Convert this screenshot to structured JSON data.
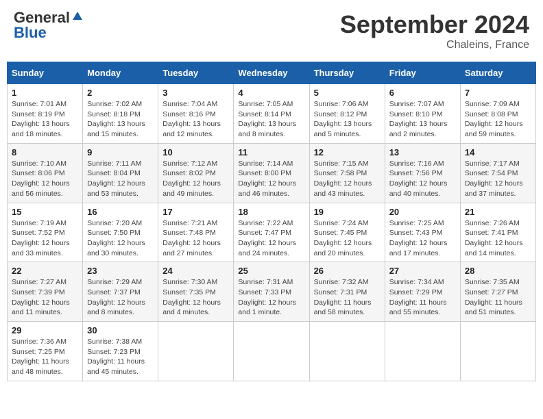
{
  "logo": {
    "line1": "General",
    "line2": "Blue"
  },
  "title": "September 2024",
  "location": "Chaleins, France",
  "days_of_week": [
    "Sunday",
    "Monday",
    "Tuesday",
    "Wednesday",
    "Thursday",
    "Friday",
    "Saturday"
  ],
  "weeks": [
    [
      {
        "day": "1",
        "info": "Sunrise: 7:01 AM\nSunset: 8:19 PM\nDaylight: 13 hours\nand 18 minutes."
      },
      {
        "day": "2",
        "info": "Sunrise: 7:02 AM\nSunset: 8:18 PM\nDaylight: 13 hours\nand 15 minutes."
      },
      {
        "day": "3",
        "info": "Sunrise: 7:04 AM\nSunset: 8:16 PM\nDaylight: 13 hours\nand 12 minutes."
      },
      {
        "day": "4",
        "info": "Sunrise: 7:05 AM\nSunset: 8:14 PM\nDaylight: 13 hours\nand 8 minutes."
      },
      {
        "day": "5",
        "info": "Sunrise: 7:06 AM\nSunset: 8:12 PM\nDaylight: 13 hours\nand 5 minutes."
      },
      {
        "day": "6",
        "info": "Sunrise: 7:07 AM\nSunset: 8:10 PM\nDaylight: 13 hours\nand 2 minutes."
      },
      {
        "day": "7",
        "info": "Sunrise: 7:09 AM\nSunset: 8:08 PM\nDaylight: 12 hours\nand 59 minutes."
      }
    ],
    [
      {
        "day": "8",
        "info": "Sunrise: 7:10 AM\nSunset: 8:06 PM\nDaylight: 12 hours\nand 56 minutes."
      },
      {
        "day": "9",
        "info": "Sunrise: 7:11 AM\nSunset: 8:04 PM\nDaylight: 12 hours\nand 53 minutes."
      },
      {
        "day": "10",
        "info": "Sunrise: 7:12 AM\nSunset: 8:02 PM\nDaylight: 12 hours\nand 49 minutes."
      },
      {
        "day": "11",
        "info": "Sunrise: 7:14 AM\nSunset: 8:00 PM\nDaylight: 12 hours\nand 46 minutes."
      },
      {
        "day": "12",
        "info": "Sunrise: 7:15 AM\nSunset: 7:58 PM\nDaylight: 12 hours\nand 43 minutes."
      },
      {
        "day": "13",
        "info": "Sunrise: 7:16 AM\nSunset: 7:56 PM\nDaylight: 12 hours\nand 40 minutes."
      },
      {
        "day": "14",
        "info": "Sunrise: 7:17 AM\nSunset: 7:54 PM\nDaylight: 12 hours\nand 37 minutes."
      }
    ],
    [
      {
        "day": "15",
        "info": "Sunrise: 7:19 AM\nSunset: 7:52 PM\nDaylight: 12 hours\nand 33 minutes."
      },
      {
        "day": "16",
        "info": "Sunrise: 7:20 AM\nSunset: 7:50 PM\nDaylight: 12 hours\nand 30 minutes."
      },
      {
        "day": "17",
        "info": "Sunrise: 7:21 AM\nSunset: 7:48 PM\nDaylight: 12 hours\nand 27 minutes."
      },
      {
        "day": "18",
        "info": "Sunrise: 7:22 AM\nSunset: 7:47 PM\nDaylight: 12 hours\nand 24 minutes."
      },
      {
        "day": "19",
        "info": "Sunrise: 7:24 AM\nSunset: 7:45 PM\nDaylight: 12 hours\nand 20 minutes."
      },
      {
        "day": "20",
        "info": "Sunrise: 7:25 AM\nSunset: 7:43 PM\nDaylight: 12 hours\nand 17 minutes."
      },
      {
        "day": "21",
        "info": "Sunrise: 7:26 AM\nSunset: 7:41 PM\nDaylight: 12 hours\nand 14 minutes."
      }
    ],
    [
      {
        "day": "22",
        "info": "Sunrise: 7:27 AM\nSunset: 7:39 PM\nDaylight: 12 hours\nand 11 minutes."
      },
      {
        "day": "23",
        "info": "Sunrise: 7:29 AM\nSunset: 7:37 PM\nDaylight: 12 hours\nand 8 minutes."
      },
      {
        "day": "24",
        "info": "Sunrise: 7:30 AM\nSunset: 7:35 PM\nDaylight: 12 hours\nand 4 minutes."
      },
      {
        "day": "25",
        "info": "Sunrise: 7:31 AM\nSunset: 7:33 PM\nDaylight: 12 hours\nand 1 minute."
      },
      {
        "day": "26",
        "info": "Sunrise: 7:32 AM\nSunset: 7:31 PM\nDaylight: 11 hours\nand 58 minutes."
      },
      {
        "day": "27",
        "info": "Sunrise: 7:34 AM\nSunset: 7:29 PM\nDaylight: 11 hours\nand 55 minutes."
      },
      {
        "day": "28",
        "info": "Sunrise: 7:35 AM\nSunset: 7:27 PM\nDaylight: 11 hours\nand 51 minutes."
      }
    ],
    [
      {
        "day": "29",
        "info": "Sunrise: 7:36 AM\nSunset: 7:25 PM\nDaylight: 11 hours\nand 48 minutes."
      },
      {
        "day": "30",
        "info": "Sunrise: 7:38 AM\nSunset: 7:23 PM\nDaylight: 11 hours\nand 45 minutes."
      },
      {
        "day": "",
        "info": ""
      },
      {
        "day": "",
        "info": ""
      },
      {
        "day": "",
        "info": ""
      },
      {
        "day": "",
        "info": ""
      },
      {
        "day": "",
        "info": ""
      }
    ]
  ]
}
